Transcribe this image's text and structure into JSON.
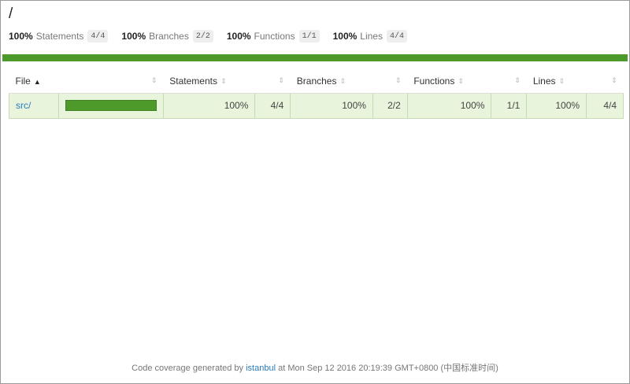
{
  "header": {
    "path": "/"
  },
  "summary": [
    {
      "pct": "100%",
      "label": "Statements",
      "fraction": "4/4"
    },
    {
      "pct": "100%",
      "label": "Branches",
      "fraction": "2/2"
    },
    {
      "pct": "100%",
      "label": "Functions",
      "fraction": "1/1"
    },
    {
      "pct": "100%",
      "label": "Lines",
      "fraction": "4/4"
    }
  ],
  "status_color": "#4d9a2b",
  "table": {
    "columns": [
      "File",
      "Statements",
      "Branches",
      "Functions",
      "Lines"
    ],
    "sort_icons": {
      "active": "sort-up-icon",
      "inactive": "sort-both-icon"
    },
    "rows": [
      {
        "file": "src/",
        "coverage_fraction": 1.0,
        "statements_pct": "100%",
        "statements_fraction": "4/4",
        "branches_pct": "100%",
        "branches_fraction": "2/2",
        "functions_pct": "100%",
        "functions_fraction": "1/1",
        "lines_pct": "100%",
        "lines_fraction": "4/4"
      }
    ]
  },
  "footer": {
    "prefix": "Code coverage generated by ",
    "link": "istanbul",
    "suffix": " at Mon Sep 12 2016 20:19:39 GMT+0800 (中国标准时间)"
  }
}
